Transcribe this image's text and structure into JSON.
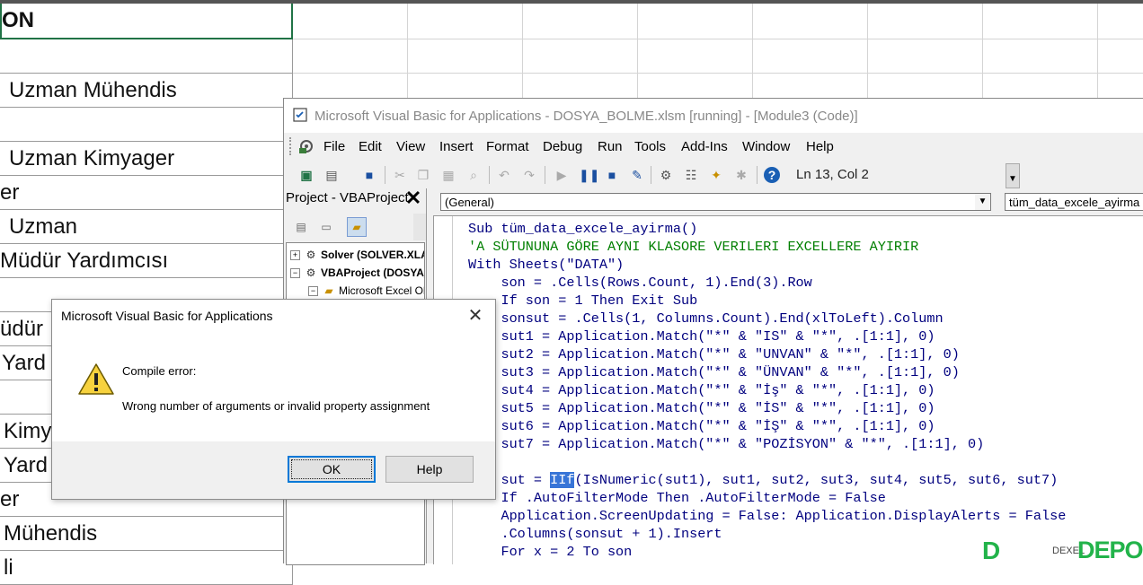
{
  "excel": {
    "cells": [
      "ON",
      "",
      "Uzman Mühendis",
      "",
      "Uzman Kimyager",
      "er",
      "Uzman",
      "Müdür Yardımcısı",
      "",
      "üdür",
      "Yard",
      "",
      "Kimy",
      "Yard",
      "er",
      "Mühendis",
      "li"
    ]
  },
  "vbe": {
    "title": "Microsoft Visual Basic for Applications - DOSYA_BOLME.xlsm [running] - [Module3 (Code)]",
    "menu": [
      "File",
      "Edit",
      "View",
      "Insert",
      "Format",
      "Debug",
      "Run",
      "Tools",
      "Add-Ins",
      "Window",
      "Help"
    ],
    "position": "Ln 13, Col 2",
    "project_title": "Project - VBAProject",
    "tree": [
      "Solver (SOLVER.XLAM)",
      "VBAProject (DOSYA_BOLME.xlsm)",
      "Microsoft Excel Objects"
    ],
    "combo_general": "(General)",
    "combo_proc": "tüm_data_excele_ayirma"
  },
  "code": {
    "l1": "Sub tüm_data_excele_ayirma()",
    "l2": "'A SÜTUNUNA GÖRE AYNI KLASORE VERILERI EXCELLERE AYIRIR",
    "l3": "With Sheets(\"DATA\")",
    "l4": "    son = .Cells(Rows.Count, 1).End(3).Row",
    "l5": "    If son = 1 Then Exit Sub",
    "l6": "    sonsut = .Cells(1, Columns.Count).End(xlToLeft).Column",
    "l7": "    sut1 = Application.Match(\"*\" & \"IS\" & \"*\", .[1:1], 0)",
    "l8": "    sut2 = Application.Match(\"*\" & \"UNVAN\" & \"*\", .[1:1], 0)",
    "l9": "    sut3 = Application.Match(\"*\" & \"ÜNVAN\" & \"*\", .[1:1], 0)",
    "l10": "    sut4 = Application.Match(\"*\" & \"İş\" & \"*\", .[1:1], 0)",
    "l11": "    sut5 = Application.Match(\"*\" & \"İS\" & \"*\", .[1:1], 0)",
    "l12": "    sut6 = Application.Match(\"*\" & \"İŞ\" & \"*\", .[1:1], 0)",
    "l13": "    sut7 = Application.Match(\"*\" & \"POZİSYON\" & \"*\", .[1:1], 0)",
    "l14": "",
    "l15a": "    sut = ",
    "l15b": "IIf",
    "l15c": "(IsNumeric(sut1), sut1, sut2, sut3, sut4, sut5, sut6, sut7)",
    "l16": "    If .AutoFilterMode Then .AutoFilterMode = False",
    "l17": "    Application.ScreenUpdating = False: Application.DisplayAlerts = False",
    "l18": "    .Columns(sonsut + 1).Insert",
    "l19": "    For x = 2 To son"
  },
  "dialog": {
    "title": "Microsoft Visual Basic for Applications",
    "line1": "Compile error:",
    "line2": "Wrong number of arguments or invalid property assignment",
    "ok": "OK",
    "help": "Help"
  },
  "watermark": {
    "text": "DEPO",
    "small": "DEXEL"
  },
  "colors": {
    "accent": "#217346",
    "code_keyword": "#00007f",
    "code_comment": "#007f00",
    "selection": "#3875d7",
    "brand_green": "#22b34a"
  }
}
